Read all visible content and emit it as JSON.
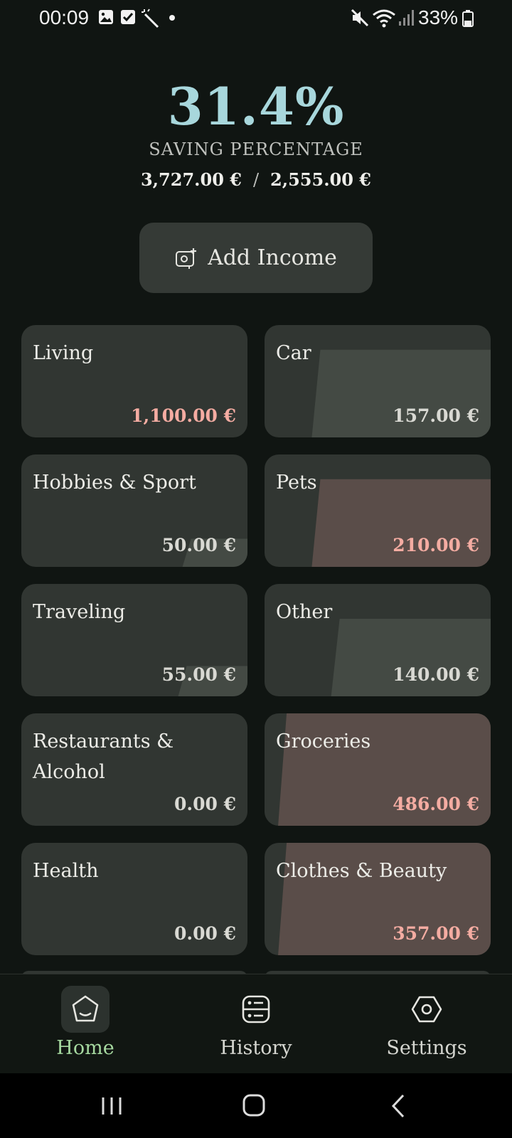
{
  "status_bar": {
    "time": "00:09",
    "battery": "33%"
  },
  "summary": {
    "saving_percentage": "31.4%",
    "label": "SAVING PERCENTAGE",
    "income": "3,727.00 €",
    "separator": "/",
    "expenses": "2,555.00 €"
  },
  "actions": {
    "add_income_label": "Add Income"
  },
  "colors": {
    "accent": "#a8d7dc",
    "over_budget": "#f4aca2",
    "nav_active": "#a6d9a0"
  },
  "categories": [
    {
      "name": "Living",
      "amount": "1,100.00 €",
      "over_budget": true,
      "fill": 0
    },
    {
      "name": "Car",
      "amount": "157.00 €",
      "over_budget": false,
      "fill": 0.78
    },
    {
      "name": "Hobbies & Sport",
      "amount": "50.00 €",
      "over_budget": false,
      "fill": 0.25
    },
    {
      "name": "Pets",
      "amount": "210.00 €",
      "over_budget": true,
      "fill": 0.78
    },
    {
      "name": "Traveling",
      "amount": "55.00 €",
      "over_budget": false,
      "fill": 0.27
    },
    {
      "name": "Other",
      "amount": "140.00 €",
      "over_budget": false,
      "fill": 0.69
    },
    {
      "name": "Restaurants & Alcohol",
      "amount": "0.00 €",
      "over_budget": false,
      "fill": 0
    },
    {
      "name": "Groceries",
      "amount": "486.00 €",
      "over_budget": true,
      "fill": 1.0
    },
    {
      "name": "Health",
      "amount": "0.00 €",
      "over_budget": false,
      "fill": 0
    },
    {
      "name": "Clothes & Beauty",
      "amount": "357.00 €",
      "over_budget": true,
      "fill": 1.0
    }
  ],
  "bottom_nav": {
    "home": "Home",
    "history": "History",
    "settings": "Settings",
    "active": "home"
  }
}
